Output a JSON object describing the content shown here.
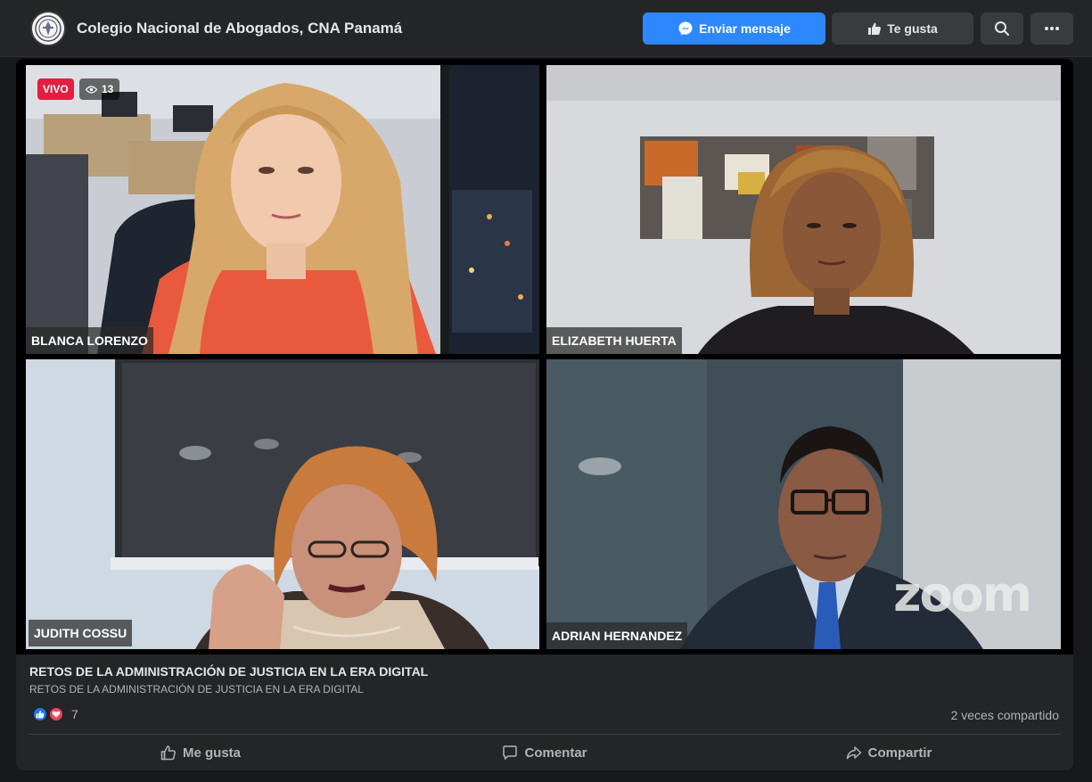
{
  "header": {
    "page_name": "Colegio Nacional de Abogados, CNA Panamá",
    "message_button": "Enviar mensaje",
    "like_button": "Te gusta"
  },
  "video": {
    "live_badge": "VIVO",
    "viewer_count": "13",
    "watermark": "zoom",
    "participants": [
      {
        "name": "BLANCA LORENZO"
      },
      {
        "name": "ELIZABETH HUERTA"
      },
      {
        "name": "JUDITH COSSU",
        "active_speaker": true
      },
      {
        "name": "ADRIAN HERNANDEZ"
      }
    ]
  },
  "post": {
    "title": "RETOS DE LA ADMINISTRACIÓN DE JUSTICIA EN LA ERA DIGITAL",
    "description": "RETOS DE LA ADMINISTRACIÓN DE JUSTICIA EN LA ERA DIGITAL",
    "reaction_count": "7",
    "shares": "2 veces compartido"
  },
  "actions": {
    "like": "Me gusta",
    "comment": "Comentar",
    "share": "Compartir"
  },
  "colors": {
    "accent": "#2d88ff",
    "live": "#e41e3f",
    "active_speaker_border": "#5fd33e"
  }
}
